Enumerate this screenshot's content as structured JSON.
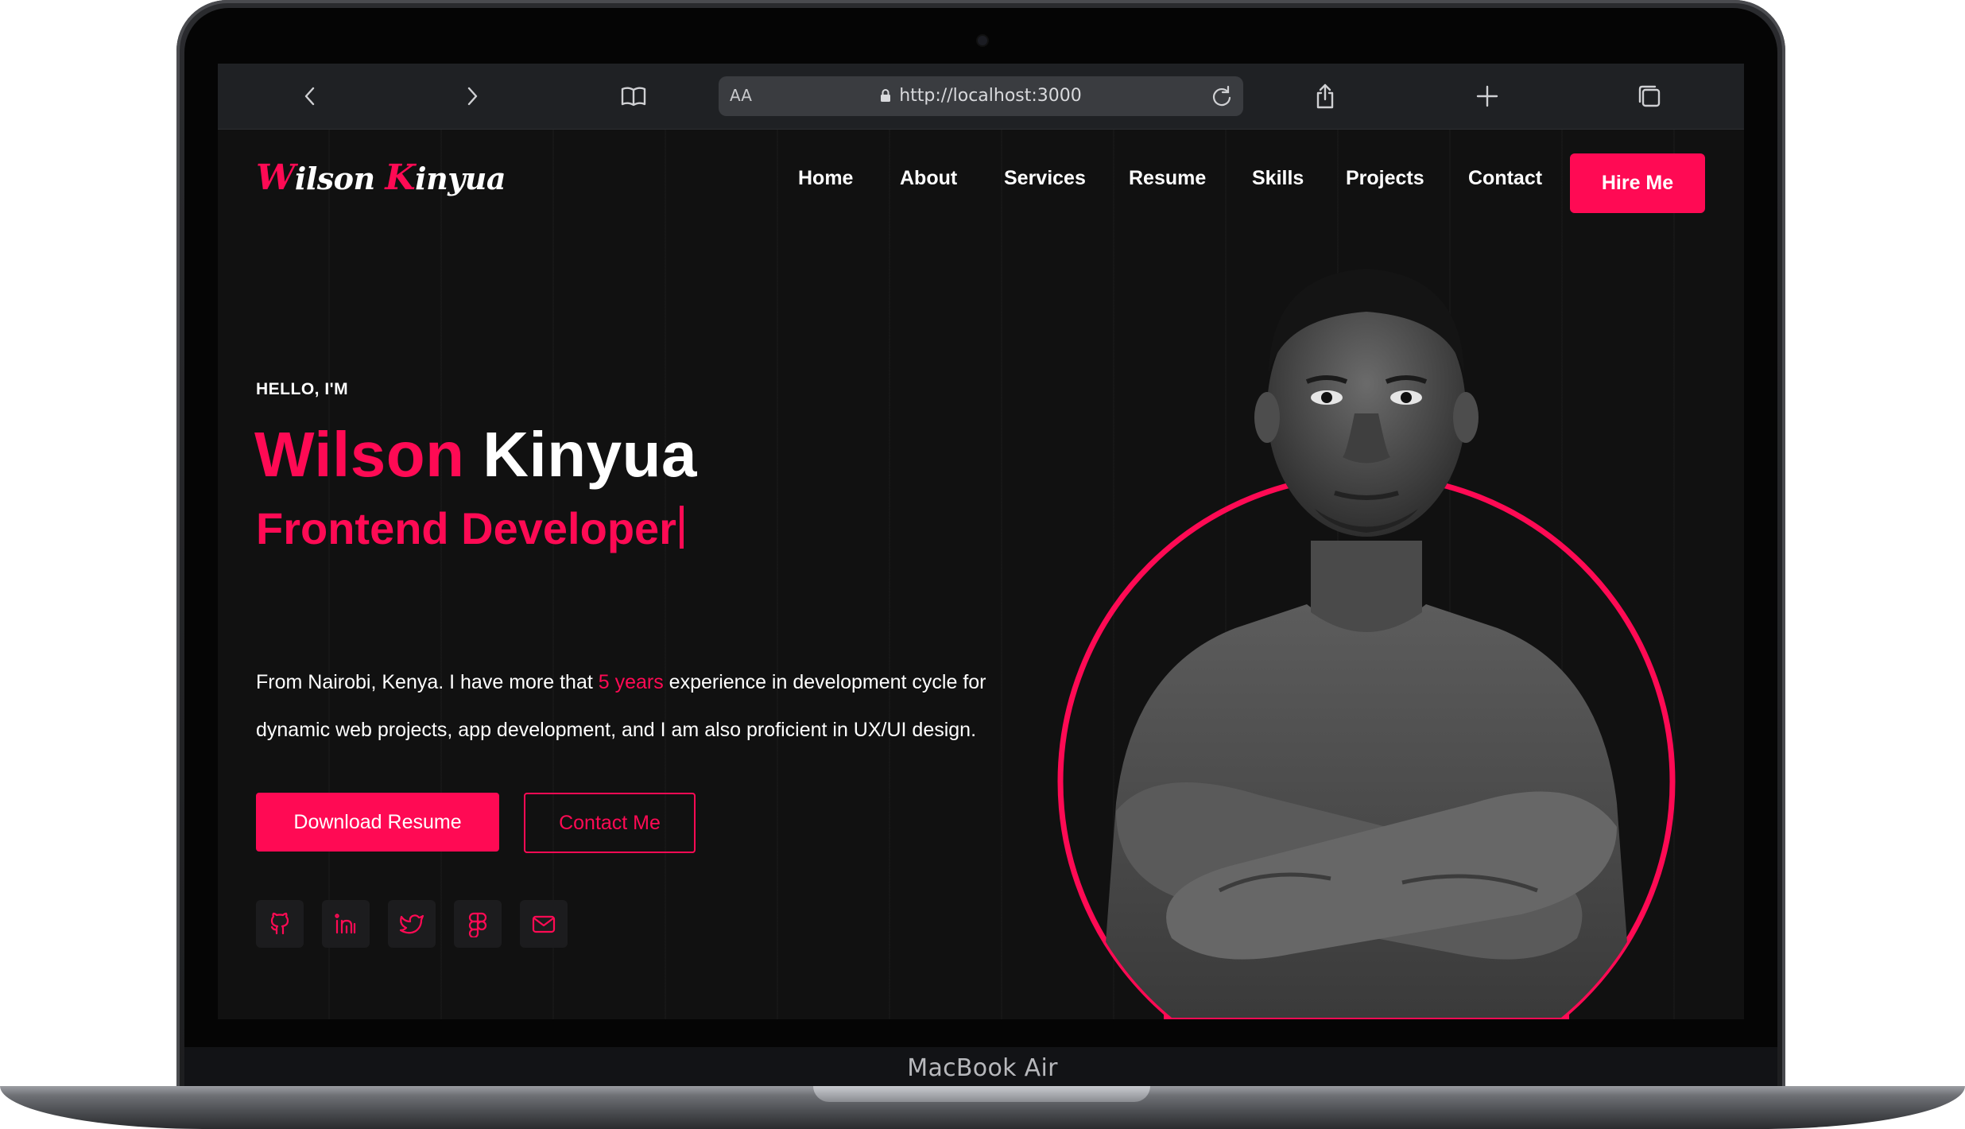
{
  "device": {
    "model_label": "MacBook Air"
  },
  "browser": {
    "reader_label": "AA",
    "url": "http://localhost:3000"
  },
  "site": {
    "logo": {
      "first_initial": "W",
      "first_rest": "ilson ",
      "last_initial": "K",
      "last_rest": "inyua"
    },
    "nav": {
      "items": [
        "Home",
        "About",
        "Services",
        "Resume",
        "Skills",
        "Projects",
        "Contact"
      ],
      "cta_label": "Hire Me"
    },
    "hero": {
      "eyebrow": "HELLO, I'M",
      "first_name": "Wilson",
      "last_name": "Kinyua",
      "role": "Frontend Developer",
      "bio_before": "From Nairobi, Kenya. I have more that ",
      "bio_highlight": "5 years",
      "bio_after": " experience in development cycle for dynamic web projects, app development, and I am also proficient in UX/UI design.",
      "primary_button": "Download Resume",
      "secondary_button": "Contact Me",
      "socials": [
        "github-icon",
        "linkedin-icon",
        "twitter-icon",
        "figma-icon",
        "mail-icon"
      ]
    }
  },
  "colors": {
    "accent": "#ff0a54",
    "background": "#111111",
    "text": "#ffffff",
    "toolbar": "#1f2124"
  }
}
